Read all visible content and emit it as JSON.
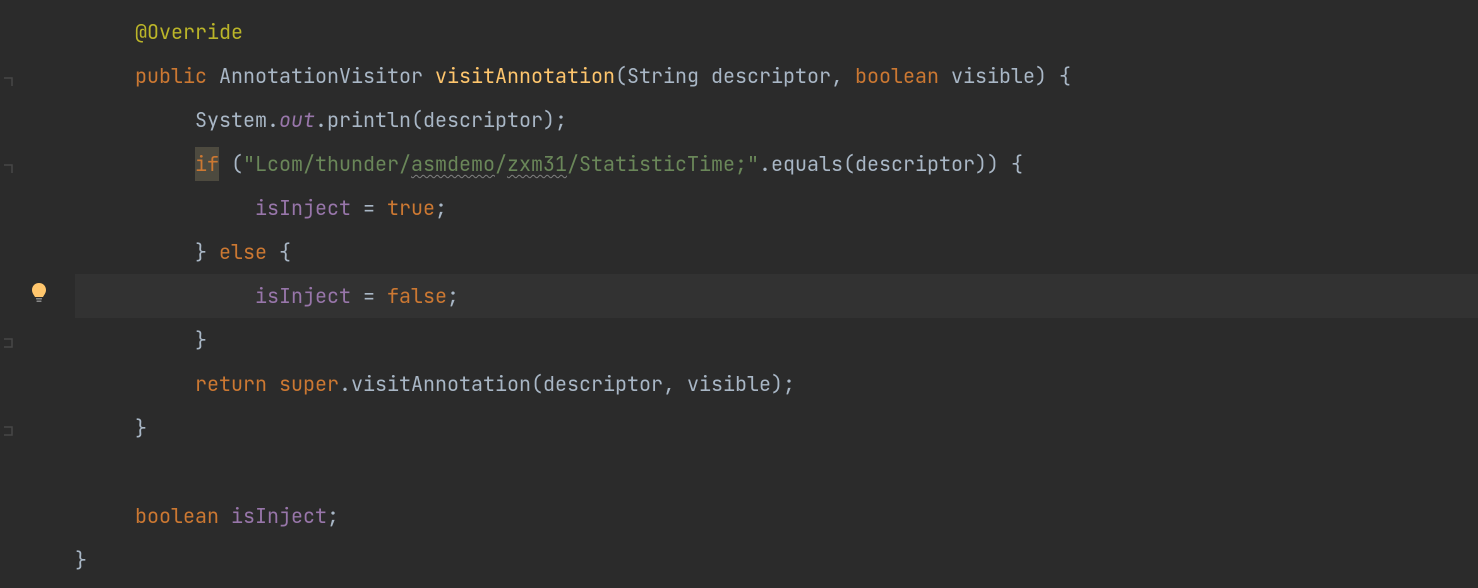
{
  "code": {
    "line1": {
      "annotation": "@Override"
    },
    "line2": {
      "kw_public": "public",
      "type": "AnnotationVisitor",
      "method": "visitAnnotation",
      "p1_type": "String",
      "p1_name": "descriptor",
      "comma": ",",
      "p2_type": "boolean",
      "p2_name": "visible",
      "rparen_brace": ") {"
    },
    "line3": {
      "system": "System",
      "dot1": ".",
      "out": "out",
      "dot2": ".",
      "println": "println",
      "lparen": "(",
      "arg": "descriptor",
      "rparen_semi": ");"
    },
    "line4": {
      "if": "if",
      "lparen": " (",
      "str_q1": "\"",
      "str_p1": "Lcom/thunder/",
      "str_p2": "asmdemo",
      "str_p3": "/",
      "str_p4": "zxm31",
      "str_p5": "/StatisticTime;",
      "str_q2": "\"",
      "dot": ".",
      "equals": "equals",
      "lparen2": "(",
      "arg": "descriptor",
      "rparen2": ")",
      "rparen_brace": ") {"
    },
    "line5": {
      "field": "isInject",
      "eq": " = ",
      "val": "true",
      "semi": ";"
    },
    "line6": {
      "rbrace": "}",
      "else": " else ",
      "lbrace": "{"
    },
    "line7": {
      "field": "isInject",
      "eq": " = ",
      "val": "false",
      "semi": ";"
    },
    "line8": {
      "rbrace": "}"
    },
    "line9": {
      "return": "return ",
      "super": "super",
      "dot": ".",
      "method": "visitAnnotation",
      "lparen": "(",
      "arg1": "descriptor",
      "comma": ", ",
      "arg2": "visible",
      "rparen_semi": ");"
    },
    "line10": {
      "rbrace": "}"
    },
    "line12": {
      "type": "boolean",
      "field": "isInject",
      "semi": ";"
    },
    "line13": {
      "rbrace": "}"
    }
  }
}
